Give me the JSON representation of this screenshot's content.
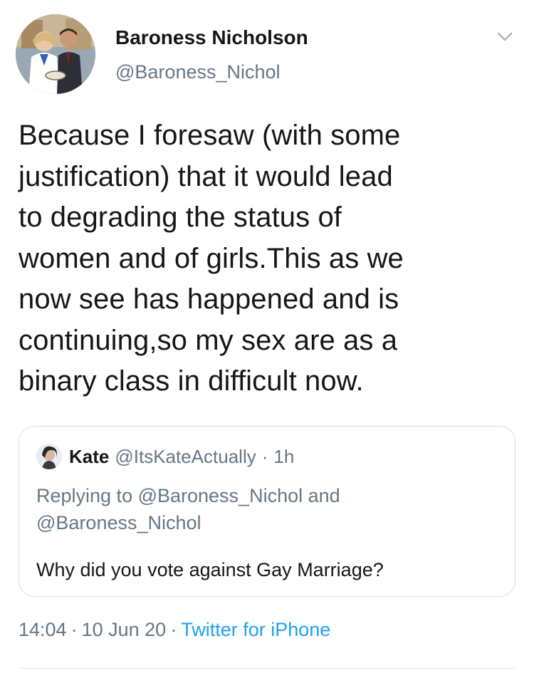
{
  "tweet": {
    "author": {
      "display_name": "Baroness Nicholson",
      "handle": "@Baroness_Nichol"
    },
    "text": "Because I foresaw (with some\njustification) that it would lead\nto degrading the status of\nwomen and of girls.This as we\nnow see has happened and is\ncontinuing,so my sex are as a\nbinary class in difficult now.",
    "menu_icon": "chevron-down-icon",
    "time": "14:04",
    "date": "10 Jun 20",
    "separator": "·",
    "source": "Twitter for iPhone"
  },
  "quoted_tweet": {
    "display_name": "Kate",
    "handle": "@ItsKateActually",
    "separator": "·",
    "age": "1h",
    "replying_to": "Replying to @Baroness_Nichol and\n@Baroness_Nichol",
    "text": "Why did you vote against Gay Marriage?"
  },
  "colors": {
    "text_primary": "#14171a",
    "text_secondary": "#657786",
    "link": "#1da1f2",
    "border": "#d6dde3"
  }
}
